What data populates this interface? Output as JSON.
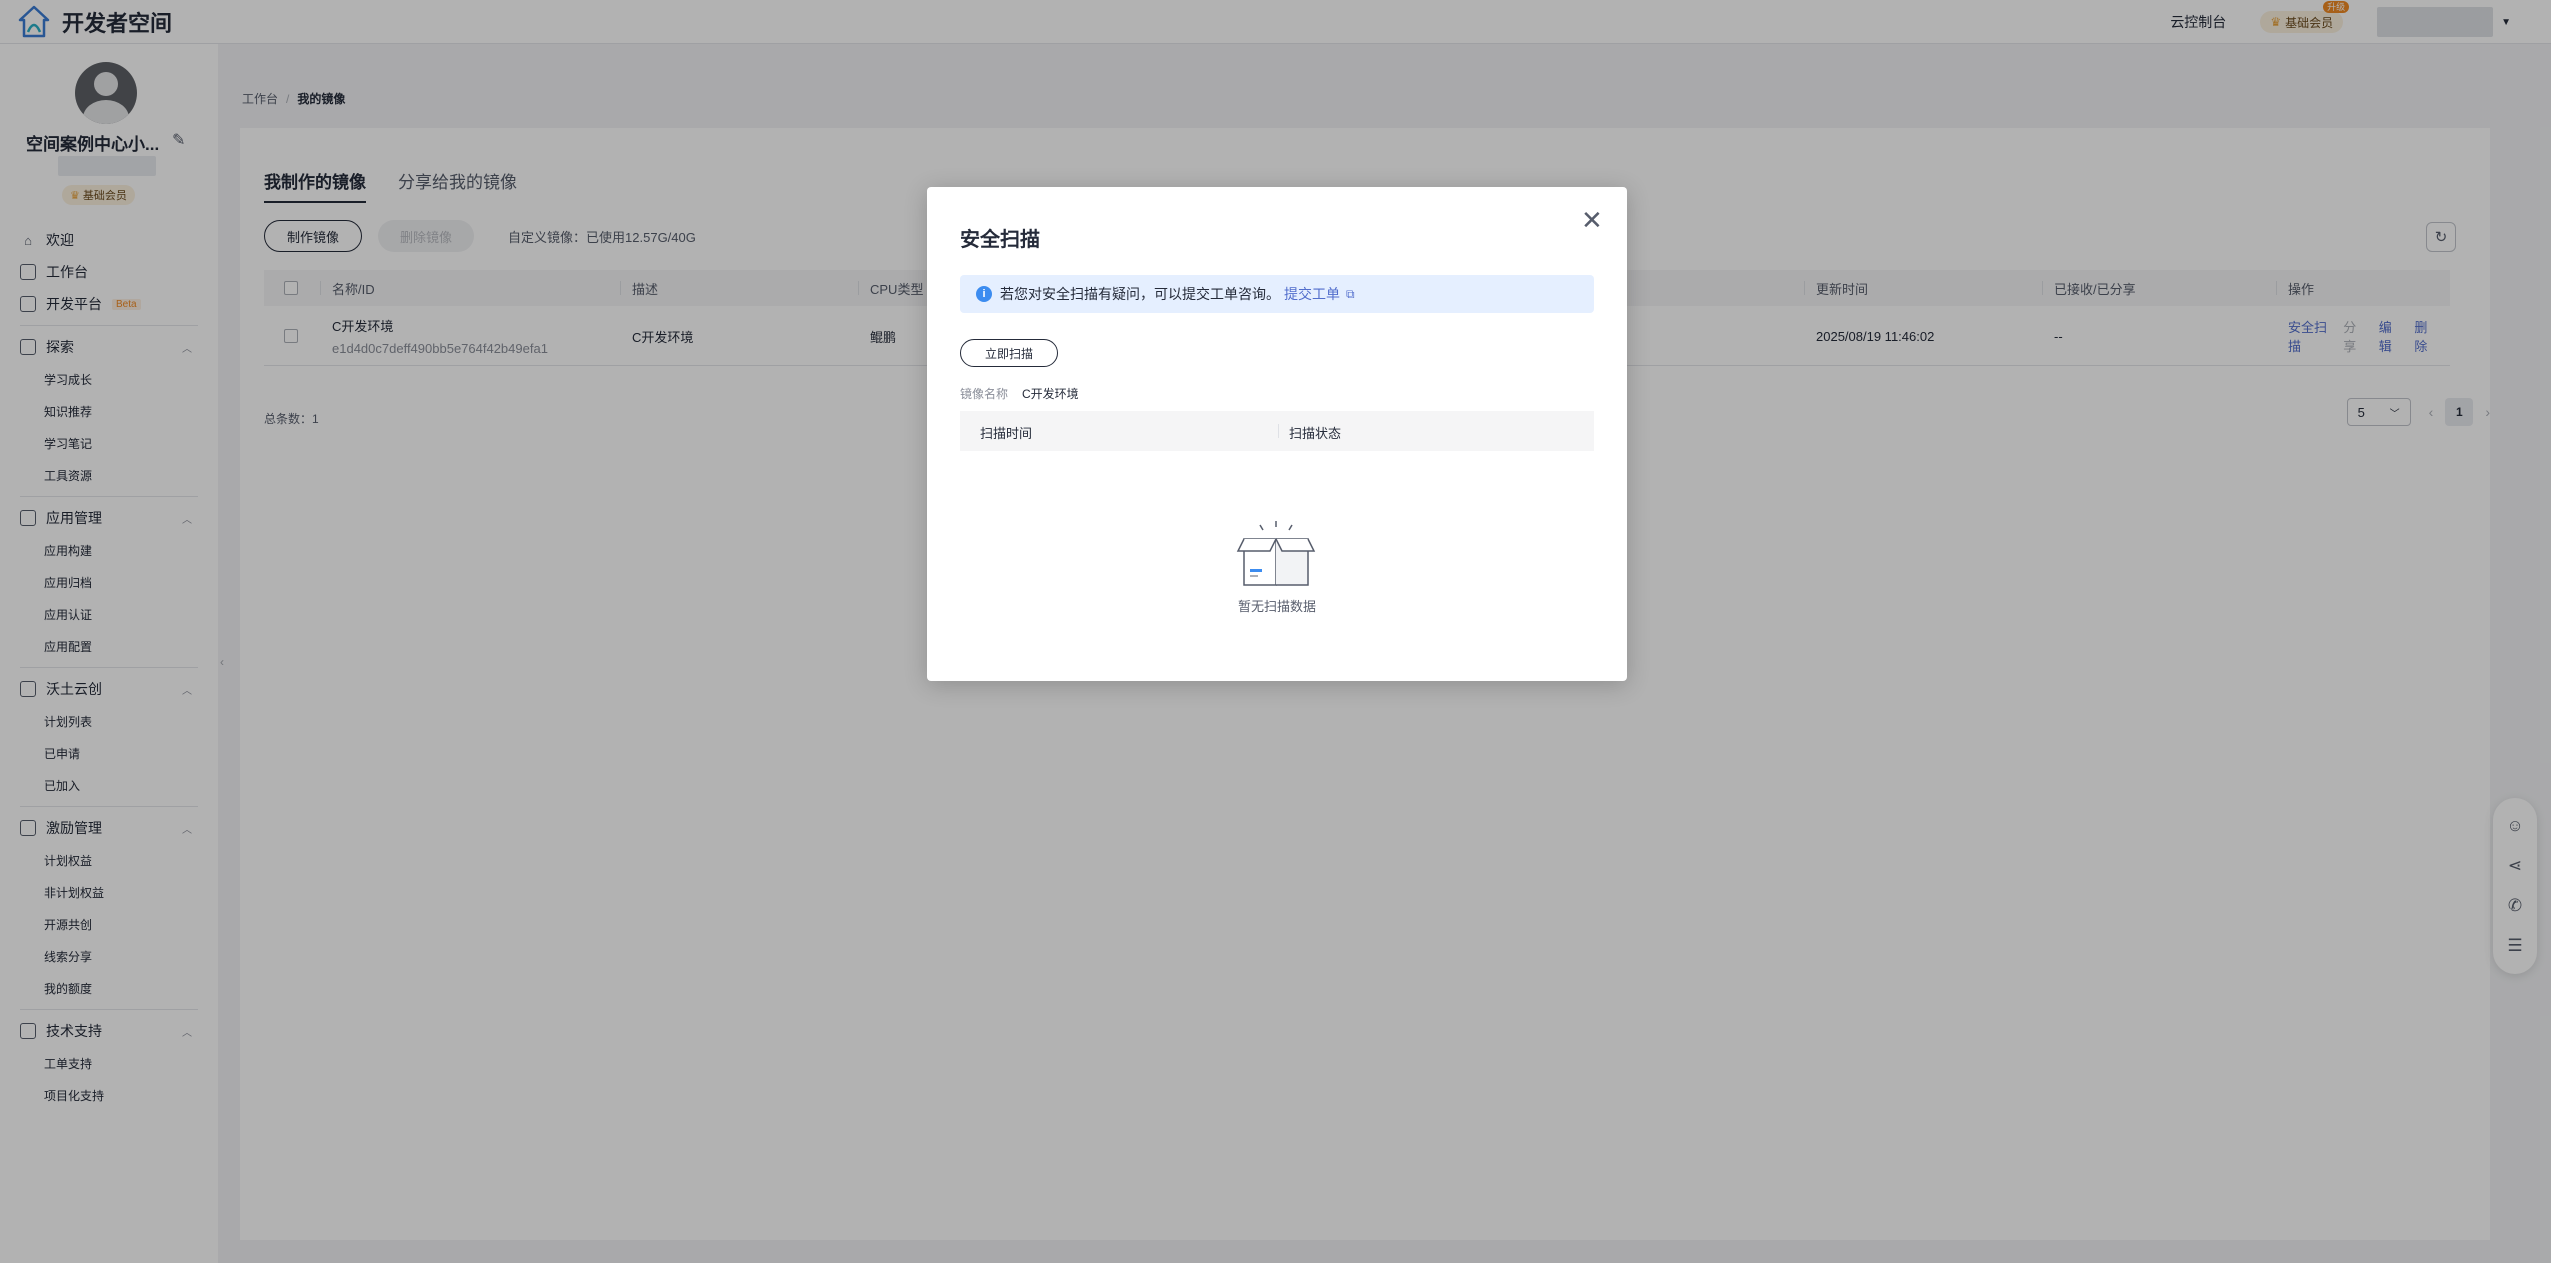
{
  "header": {
    "app_title": "开发者空间",
    "console_link": "云控制台",
    "member_badge": "基础会员",
    "member_upgrade": "升级"
  },
  "sidebar": {
    "space_name": "空间案例中心小...",
    "member_badge": "基础会员",
    "top_items": [
      {
        "label": "欢迎",
        "icon": "home-icon"
      },
      {
        "label": "工作台",
        "icon": "workbench-icon"
      },
      {
        "label": "开发平台",
        "icon": "dev-platform-icon",
        "badge": "Beta"
      }
    ],
    "groups": [
      {
        "label": "探索",
        "icon": "explore-icon",
        "items": [
          "学习成长",
          "知识推荐",
          "学习笔记",
          "工具资源"
        ]
      },
      {
        "label": "应用管理",
        "icon": "app-manage-icon",
        "items": [
          "应用构建",
          "应用归档",
          "应用认证",
          "应用配置"
        ]
      },
      {
        "label": "沃土云创",
        "icon": "cloud-create-icon",
        "items": [
          "计划列表",
          "已申请",
          "已加入"
        ]
      },
      {
        "label": "激励管理",
        "icon": "gift-icon",
        "items": [
          "计划权益",
          "非计划权益",
          "开源共创",
          "线索分享",
          "我的额度"
        ]
      },
      {
        "label": "技术支持",
        "icon": "support-icon",
        "items": [
          "工单支持",
          "项目化支持"
        ]
      }
    ]
  },
  "breadcrumb": {
    "parent": "工作台",
    "current": "我的镜像"
  },
  "tabs": [
    "我制作的镜像",
    "分享给我的镜像"
  ],
  "toolbar": {
    "create_label": "制作镜像",
    "delete_label": "删除镜像",
    "quota_text": "自定义镜像：已使用12.57G/40G"
  },
  "table": {
    "headers": [
      "名称/ID",
      "描述",
      "CPU类型",
      "更新时间",
      "已接收/已分享",
      "操作"
    ],
    "rows": [
      {
        "name": "C开发环境",
        "id": "e1d4d0c7deff490bb5e764f42b49efa1",
        "desc": "C开发环境",
        "cpu": "鲲鹏",
        "updated": "2025/08/19 11:46:02",
        "shared": "--",
        "actions": {
          "scan": "安全扫描",
          "share": "分享",
          "edit": "编辑",
          "delete": "删除"
        }
      }
    ]
  },
  "pagination": {
    "total_text": "总条数：1",
    "page_size": "5",
    "current_page": "1"
  },
  "modal": {
    "title": "安全扫描",
    "info_text": "若您对安全扫描有疑问，可以提交工单咨询。",
    "info_link": "提交工单",
    "scan_button": "立即扫描",
    "image_name_label": "镜像名称",
    "image_name_value": "C开发环境",
    "headers": [
      "扫描时间",
      "扫描状态"
    ],
    "empty_text": "暂无扫描数据"
  }
}
